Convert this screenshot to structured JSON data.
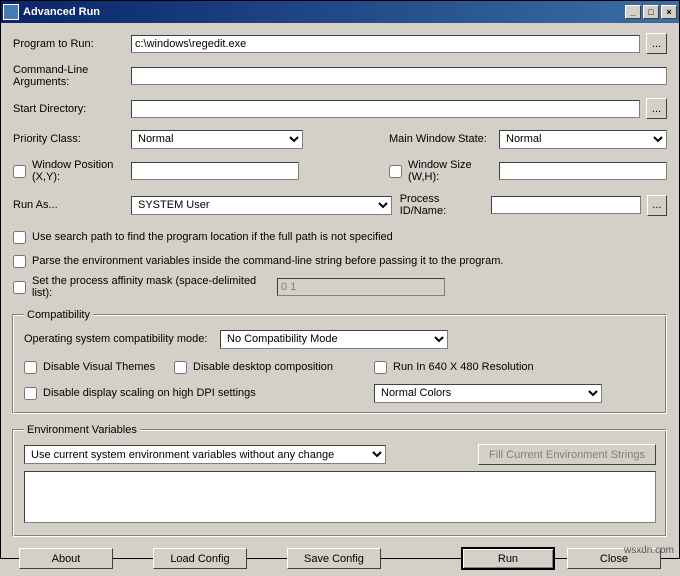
{
  "window": {
    "title": "Advanced Run"
  },
  "labels": {
    "program_to_run": "Program to Run:",
    "cmd_args": "Command-Line Arguments:",
    "start_dir": "Start Directory:",
    "priority_class": "Priority Class:",
    "main_window_state": "Main Window State:",
    "window_position": "Window Position (X,Y):",
    "window_size": "Window Size (W,H):",
    "run_as": "Run As...",
    "process_id_name": "Process ID/Name:",
    "use_search_path": "Use search path to find the program location if the full path is not specified",
    "parse_env": "Parse the environment variables inside the command-line string before passing it to the program.",
    "set_affinity": "Set the process affinity mask (space-delimited list):",
    "compatibility_legend": "Compatibility",
    "os_compat_mode": "Operating system compatibility mode:",
    "disable_visual_themes": "Disable Visual Themes",
    "disable_desktop_comp": "Disable desktop composition",
    "run_640_480": "Run In 640 X 480 Resolution",
    "disable_dpi_scaling": "Disable display scaling on high DPI settings",
    "env_vars_legend": "Environment Variables"
  },
  "values": {
    "program_to_run": "c:\\windows\\regedit.exe",
    "cmd_args": "",
    "start_dir": "",
    "priority_class": "Normal",
    "main_window_state": "Normal",
    "window_position": "",
    "window_size": "",
    "run_as": "SYSTEM User",
    "process_id_name": "",
    "affinity_list": "0 1",
    "os_compat_mode": "No Compatibility Mode",
    "color_mode": "Normal Colors",
    "env_mode": "Use current system environment variables without any change",
    "env_text": ""
  },
  "checks": {
    "window_position": false,
    "window_size": false,
    "use_search_path": false,
    "parse_env": false,
    "set_affinity": false,
    "disable_visual_themes": false,
    "disable_desktop_comp": false,
    "run_640_480": false,
    "disable_dpi_scaling": false
  },
  "buttons": {
    "browse": "...",
    "fill_env": "Fill Current Environment Strings",
    "about": "About",
    "load_config": "Load Config",
    "save_config": "Save Config",
    "run": "Run",
    "close": "Close"
  },
  "watermark": "wsxdn.com"
}
